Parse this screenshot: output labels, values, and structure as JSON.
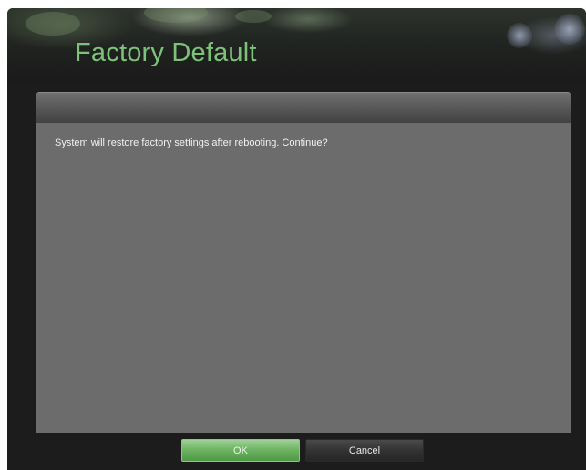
{
  "dialog": {
    "title": "Factory Default",
    "message": "System will restore factory settings after rebooting. Continue?"
  },
  "buttons": {
    "ok_label": "OK",
    "cancel_label": "Cancel"
  },
  "colors": {
    "title_green": "#7ec27a",
    "panel_gray": "#6c6c6c",
    "window_dark": "#1c1c1c",
    "ok_green": "#6ab160"
  }
}
